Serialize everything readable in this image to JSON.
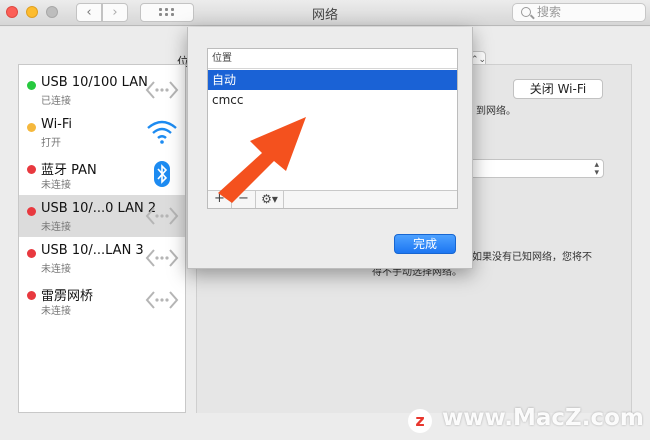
{
  "window": {
    "title": "网络",
    "search_placeholder": "搜索",
    "nav_back": "‹",
    "nav_forward": "›"
  },
  "location": {
    "label_fragment": "位",
    "select_arrows": "⌃⌄"
  },
  "services": [
    {
      "name": "USB 10/100 LAN",
      "status": "已连接",
      "dot": "green",
      "icon": "ethernet-icon"
    },
    {
      "name": "Wi-Fi",
      "status": "打开",
      "dot": "yellow",
      "icon": "wifi-icon"
    },
    {
      "name": "蓝牙 PAN",
      "status": "未连接",
      "dot": "red",
      "icon": "bluetooth-icon"
    },
    {
      "name": "USB 10/...0 LAN 2",
      "status": "未连接",
      "dot": "red",
      "icon": "ethernet-icon"
    },
    {
      "name": "USB 10/...LAN 3",
      "status": "未连接",
      "dot": "red",
      "icon": "ethernet-icon"
    },
    {
      "name": "雷雳网桥",
      "status": "未连接",
      "dot": "red",
      "icon": "ethernet-icon"
    }
  ],
  "selected_service_index": 3,
  "right_panel": {
    "wifi_button": "关闭 Wi-Fi",
    "known_networks_fragment": "到网络。",
    "hint_line1": "将自动加入已知网络。如果没有已知网络，您将不",
    "hint_line2": "得不手动选择网络。"
  },
  "sheet": {
    "list_header": "位置",
    "locations": [
      "自动",
      "cmcc"
    ],
    "selected_location_index": 0,
    "add_label": "+",
    "remove_label": "−",
    "gear_label": "⚙▾",
    "done_label": "完成"
  },
  "colors": {
    "accent": "#1a62d6",
    "done_button": "#2a84f7",
    "arrow": "#f4511e",
    "status_green": "#27c93f",
    "status_yellow": "#f5b83d",
    "status_red": "#e8393f"
  },
  "watermark": {
    "logo": "z",
    "text": "www.MacZ.com"
  }
}
